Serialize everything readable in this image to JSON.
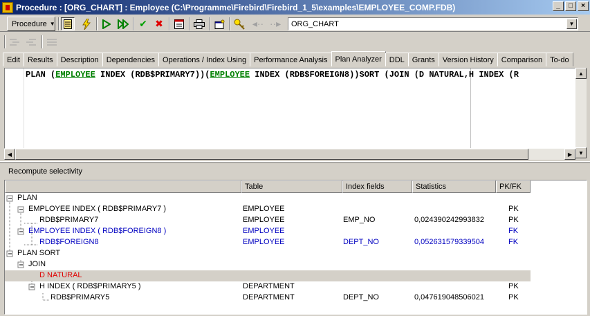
{
  "window": {
    "title": "Procedure : [ORG_CHART] : Employee (C:\\Programme\\Firebird\\Firebird_1_5\\examples\\EMPLOYEE_COMP.FDB)",
    "minimize": "_",
    "maximize": "□",
    "close": "×"
  },
  "toolbar": {
    "procedure_label": "Procedure",
    "procedure_combo_value": "ORG_CHART"
  },
  "tabs": [
    "Edit",
    "Results",
    "Description",
    "Dependencies",
    "Operations / Index Using",
    "Performance Analysis",
    "Plan Analyzer",
    "DDL",
    "Grants",
    "Version History",
    "Comparison",
    "To-do"
  ],
  "editor": {
    "seg1": "PLAN (",
    "tbl1": "EMPLOYEE",
    "seg2": " INDEX (RDB$PRIMARY7))(",
    "tbl2": "EMPLOYEE",
    "seg3": " INDEX (RDB$FOREIGN8))SORT (JOIN (D NATURAL,H INDEX (R"
  },
  "recompute_label": "Recompute selectivity",
  "grid": {
    "headers": [
      "",
      "Table",
      "Index fields",
      "Statistics",
      "PK/FK"
    ],
    "rows": [
      {
        "name": "PLAN",
        "table": "",
        "index": "",
        "stat": "",
        "pkfk": ""
      },
      {
        "name": "EMPLOYEE INDEX ( RDB$PRIMARY7 )",
        "table": "EMPLOYEE",
        "index": "",
        "stat": "",
        "pkfk": "PK"
      },
      {
        "name": "RDB$PRIMARY7",
        "table": "EMPLOYEE",
        "index": "EMP_NO",
        "stat": "0,024390242993832",
        "pkfk": "PK"
      },
      {
        "name": "EMPLOYEE INDEX ( RDB$FOREIGN8 )",
        "table": "EMPLOYEE",
        "index": "",
        "stat": "",
        "pkfk": "FK"
      },
      {
        "name": "RDB$FOREIGN8",
        "table": "EMPLOYEE",
        "index": "DEPT_NO",
        "stat": "0,052631579339504",
        "pkfk": "FK"
      },
      {
        "name": "PLAN SORT",
        "table": "",
        "index": "",
        "stat": "",
        "pkfk": ""
      },
      {
        "name": "JOIN",
        "table": "",
        "index": "",
        "stat": "",
        "pkfk": ""
      },
      {
        "name": "D NATURAL",
        "table": "",
        "index": "",
        "stat": "",
        "pkfk": ""
      },
      {
        "name": "H INDEX ( RDB$PRIMARY5 )",
        "table": "DEPARTMENT",
        "index": "",
        "stat": "",
        "pkfk": "PK"
      },
      {
        "name": "RDB$PRIMARY5",
        "table": "DEPARTMENT",
        "index": "DEPT_NO",
        "stat": "0,047619048506021",
        "pkfk": "PK"
      }
    ]
  },
  "colors": {
    "fk_row": "#0000c0",
    "natural_row": "#e00000",
    "table_link": "#008000"
  }
}
